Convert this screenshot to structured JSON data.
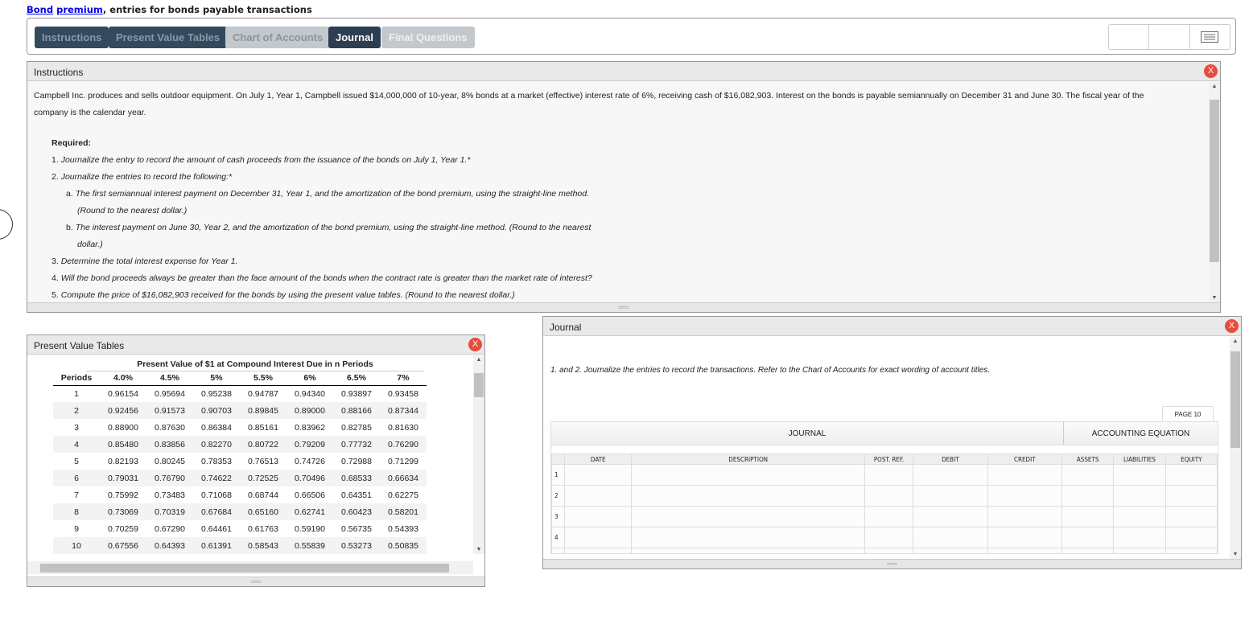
{
  "title": {
    "link1": "Bond",
    "link2": "premium",
    "rest": ", entries for bonds payable transactions"
  },
  "tabs": [
    "Instructions",
    "Present Value Tables",
    "Chart of Accounts",
    "Journal",
    "Final Questions"
  ],
  "instructions": {
    "header": "Instructions",
    "close": "X",
    "intro": "Campbell Inc. produces and sells outdoor equipment. On July 1, Year 1, Campbell issued $14,000,000 of 10-year, 8% bonds at a market (effective) interest rate of 6%, receiving cash of $16,082,903. Interest on the bonds is payable semiannually on December 31 and June 30. The fiscal year of the company is the calendar year.",
    "required": "Required:",
    "items": [
      {
        "n": "1.",
        "t": "Journalize the entry to record the amount of cash proceeds from the issuance of the bonds on July 1, Year 1.*"
      },
      {
        "n": "2.",
        "t": "Journalize the entries to record the following:*"
      },
      {
        "n": "a.",
        "t": "The first semiannual interest payment on December 31, Year 1, and the amortization of the bond premium, using the straight-line method.",
        "t2": "(Round to the nearest dollar.)"
      },
      {
        "n": "b.",
        "t": "The interest payment on June 30, Year 2, and the amortization of the bond premium, using the straight-line method. (Round to the nearest",
        "t2": "dollar.)"
      },
      {
        "n": "3.",
        "t": "Determine the total interest expense for Year 1."
      },
      {
        "n": "4.",
        "t": "Will the bond proceeds always be greater than the face amount of the bonds when the contract rate is greater than the market rate of interest?"
      },
      {
        "n": "5.",
        "t": "Compute the price of $16,082,903 received for the bonds by using the present value tables. (Round to the nearest dollar.)"
      }
    ]
  },
  "pv": {
    "header": "Present Value Tables",
    "close": "X",
    "caption": "Present Value of $1 at Compound Interest Due in n Periods",
    "columns": [
      "Periods",
      "4.0%",
      "4.5%",
      "5%",
      "5.5%",
      "6%",
      "6.5%",
      "7%"
    ],
    "rows": [
      [
        "1",
        "0.96154",
        "0.95694",
        "0.95238",
        "0.94787",
        "0.94340",
        "0.93897",
        "0.93458"
      ],
      [
        "2",
        "0.92456",
        "0.91573",
        "0.90703",
        "0.89845",
        "0.89000",
        "0.88166",
        "0.87344"
      ],
      [
        "3",
        "0.88900",
        "0.87630",
        "0.86384",
        "0.85161",
        "0.83962",
        "0.82785",
        "0.81630"
      ],
      [
        "4",
        "0.85480",
        "0.83856",
        "0.82270",
        "0.80722",
        "0.79209",
        "0.77732",
        "0.76290"
      ],
      [
        "5",
        "0.82193",
        "0.80245",
        "0.78353",
        "0.76513",
        "0.74726",
        "0.72988",
        "0.71299"
      ],
      [
        "6",
        "0.79031",
        "0.76790",
        "0.74622",
        "0.72525",
        "0.70496",
        "0.68533",
        "0.66634"
      ],
      [
        "7",
        "0.75992",
        "0.73483",
        "0.71068",
        "0.68744",
        "0.66506",
        "0.64351",
        "0.62275"
      ],
      [
        "8",
        "0.73069",
        "0.70319",
        "0.67684",
        "0.65160",
        "0.62741",
        "0.60423",
        "0.58201"
      ],
      [
        "9",
        "0.70259",
        "0.67290",
        "0.64461",
        "0.61763",
        "0.59190",
        "0.56735",
        "0.54393"
      ],
      [
        "10",
        "0.67556",
        "0.64393",
        "0.61391",
        "0.58543",
        "0.55839",
        "0.53273",
        "0.50835"
      ]
    ]
  },
  "journal": {
    "header": "Journal",
    "close": "X",
    "instruction": "1. and 2. Journalize the entries to record the transactions. Refer to the Chart of Accounts for exact wording of account titles.",
    "page": "PAGE 10",
    "group_journal": "JOURNAL",
    "group_equation": "ACCOUNTING EQUATION",
    "columns": [
      "DATE",
      "DESCRIPTION",
      "POST. REF.",
      "DEBIT",
      "CREDIT",
      "ASSETS",
      "LIABILITIES",
      "EQUITY"
    ],
    "row_numbers": [
      "1",
      "2",
      "3",
      "4"
    ]
  }
}
